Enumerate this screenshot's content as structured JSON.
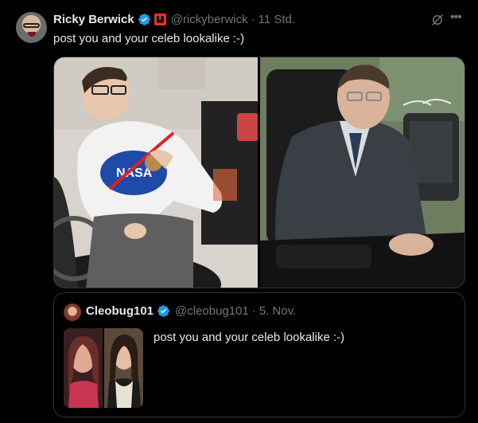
{
  "tweet": {
    "author": {
      "name": "Ricky Berwick",
      "handle": "@rickyberwick",
      "time": "11 Std.",
      "separator": "·",
      "verified": true,
      "avatar_icon": "avatar"
    },
    "text": "post you and your celeb lookalike :-)",
    "icons": {
      "grok": "grok-icon",
      "more": "more-icon"
    }
  },
  "quote": {
    "author": {
      "name": "Cleobug101",
      "handle": "@cleobug101",
      "time": "5. Nov.",
      "separator": "·",
      "verified": true
    },
    "text": "post you and your celeb lookalike :-)"
  },
  "colors": {
    "background": "#000000",
    "text": "#e7e9ea",
    "muted": "#71767b",
    "border": "#2f3336",
    "verified": "#1d9bf0",
    "affiliate": "#e0342c"
  }
}
